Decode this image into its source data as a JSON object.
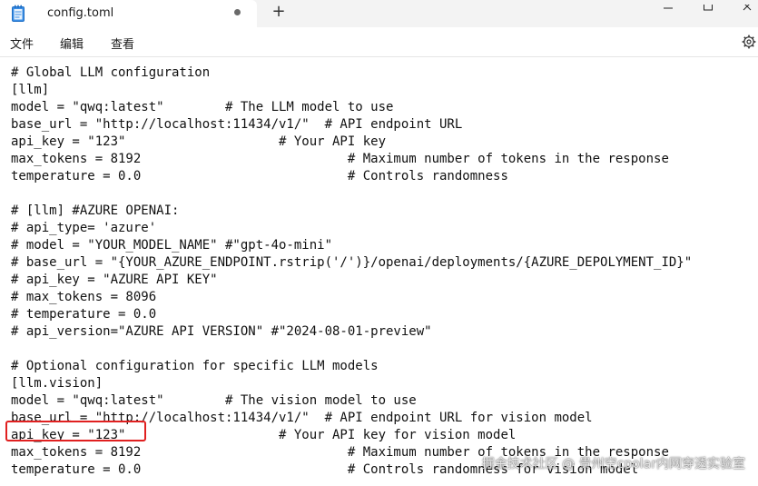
{
  "tab": {
    "title": "config.toml",
    "icon": "notepad-icon",
    "unsaved_indicator": "dot"
  },
  "new_tab_label": "+",
  "menu": {
    "file": "文件",
    "edit": "编辑",
    "view": "查看"
  },
  "editor_lines": [
    "# Global LLM configuration",
    "[llm]",
    "model = \"qwq:latest\"        # The LLM model to use",
    "base_url = \"http://localhost:11434/v1/\"  # API endpoint URL",
    "api_key = \"123\"                    # Your API key",
    "max_tokens = 8192                           # Maximum number of tokens in the response",
    "temperature = 0.0                           # Controls randomness",
    "",
    "# [llm] #AZURE OPENAI:",
    "# api_type= 'azure'",
    "# model = \"YOUR_MODEL_NAME\" #\"gpt-4o-mini\"",
    "# base_url = \"{YOUR_AZURE_ENDPOINT.rstrip('/')}/openai/deployments/{AZURE_DEPOLYMENT_ID}\"",
    "# api_key = \"AZURE API KEY\"",
    "# max_tokens = 8096",
    "# temperature = 0.0",
    "# api_version=\"AZURE API VERSION\" #\"2024-08-01-preview\"",
    "",
    "# Optional configuration for specific LLM models",
    "[llm.vision]",
    "model = \"qwq:latest\"        # The vision model to use",
    "base_url = \"http://localhost:11434/v1/\"  # API endpoint URL for vision model",
    "api_key = \"123\"                    # Your API key for vision model",
    "max_tokens = 8192                           # Maximum number of tokens in the response",
    "temperature = 0.0                           # Controls randomness for vision model"
  ],
  "watermark": "掘金技术社区 @ 贵州空cpolar内网穿透实验室",
  "colors": {
    "highlight": "#e02020",
    "titlebar": "#f3f3f3"
  }
}
